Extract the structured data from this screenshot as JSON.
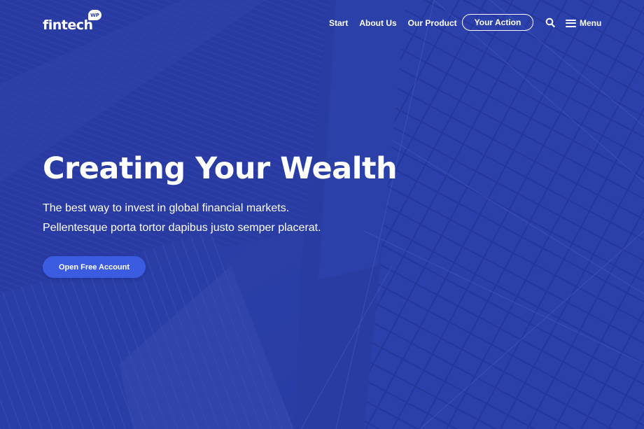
{
  "brand": {
    "logo_text": "fintech",
    "logo_badge": "WP"
  },
  "nav": {
    "items": [
      {
        "label": "Start"
      },
      {
        "label": "About Us"
      },
      {
        "label": "Our Product"
      }
    ],
    "cta_label": "Your Action",
    "search_icon": "search-icon",
    "menu_icon": "hamburger-icon",
    "menu_label": "Menu"
  },
  "hero": {
    "title": "Creating Your Wealth",
    "subtitle_line1": "The best way to invest in global financial markets.",
    "subtitle_line2": "Pellentesque porta tortor dapibus justo semper placerat.",
    "cta_label": "Open Free Account"
  },
  "colors": {
    "background": "#2a3da0",
    "cta_button": "#3b5ce0",
    "text": "#ffffff"
  }
}
